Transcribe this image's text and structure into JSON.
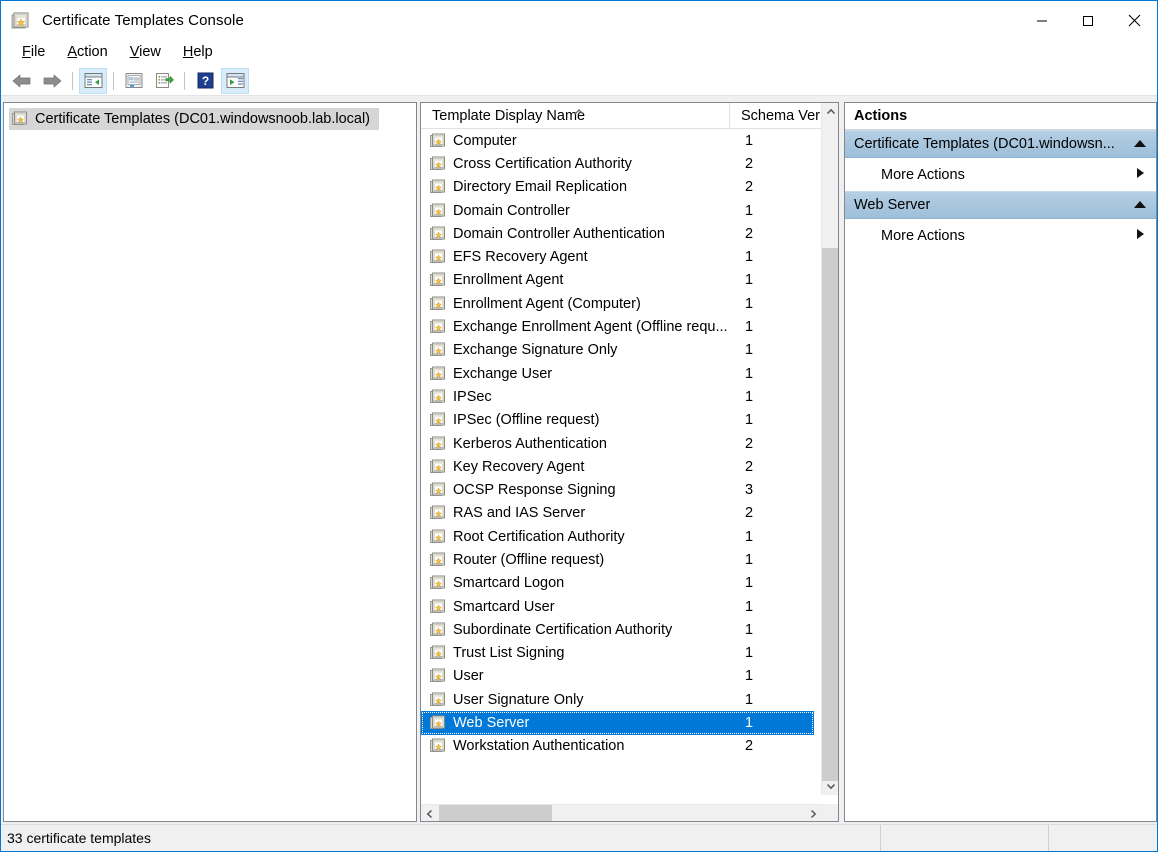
{
  "window": {
    "title": "Certificate Templates Console",
    "icon": "certificate-template-icon",
    "controls": {
      "minimize": "Minimize",
      "maximize": "Maximize",
      "close": "Close"
    }
  },
  "menu": {
    "items": [
      "File",
      "Action",
      "View",
      "Help"
    ]
  },
  "toolbar": {
    "buttons": [
      {
        "name": "back-button",
        "icon": "back-arrow-icon",
        "active": false
      },
      {
        "name": "forward-button",
        "icon": "forward-arrow-icon",
        "active": false
      },
      {
        "name": "show-hide-tree-button",
        "icon": "console-tree-icon",
        "active": true
      },
      {
        "name": "properties-button",
        "icon": "properties-icon",
        "active": false
      },
      {
        "name": "export-list-button",
        "icon": "export-list-icon",
        "active": false
      },
      {
        "name": "help-button",
        "icon": "help-icon",
        "active": false
      },
      {
        "name": "show-hide-action-pane-button",
        "icon": "action-pane-icon",
        "active": true
      }
    ]
  },
  "tree": {
    "root": {
      "label": "Certificate Templates (DC01.windowsnoob.lab.local)",
      "icon": "certificate-template-icon",
      "selected": true
    }
  },
  "list": {
    "columns": [
      "Template Display Name",
      "Schema Ver"
    ],
    "sort": {
      "column": "Template Display Name",
      "direction": "ascending"
    },
    "rows": [
      {
        "name": "Computer",
        "version": "1",
        "selected": false
      },
      {
        "name": "Cross Certification Authority",
        "version": "2",
        "selected": false
      },
      {
        "name": "Directory Email Replication",
        "version": "2",
        "selected": false
      },
      {
        "name": "Domain Controller",
        "version": "1",
        "selected": false
      },
      {
        "name": "Domain Controller Authentication",
        "version": "2",
        "selected": false
      },
      {
        "name": "EFS Recovery Agent",
        "version": "1",
        "selected": false
      },
      {
        "name": "Enrollment Agent",
        "version": "1",
        "selected": false
      },
      {
        "name": "Enrollment Agent (Computer)",
        "version": "1",
        "selected": false
      },
      {
        "name": "Exchange Enrollment Agent (Offline requ...",
        "version": "1",
        "selected": false
      },
      {
        "name": "Exchange Signature Only",
        "version": "1",
        "selected": false
      },
      {
        "name": "Exchange User",
        "version": "1",
        "selected": false
      },
      {
        "name": "IPSec",
        "version": "1",
        "selected": false
      },
      {
        "name": "IPSec (Offline request)",
        "version": "1",
        "selected": false
      },
      {
        "name": "Kerberos Authentication",
        "version": "2",
        "selected": false
      },
      {
        "name": "Key Recovery Agent",
        "version": "2",
        "selected": false
      },
      {
        "name": "OCSP Response Signing",
        "version": "3",
        "selected": false
      },
      {
        "name": "RAS and IAS Server",
        "version": "2",
        "selected": false
      },
      {
        "name": "Root Certification Authority",
        "version": "1",
        "selected": false
      },
      {
        "name": "Router (Offline request)",
        "version": "1",
        "selected": false
      },
      {
        "name": "Smartcard Logon",
        "version": "1",
        "selected": false
      },
      {
        "name": "Smartcard User",
        "version": "1",
        "selected": false
      },
      {
        "name": "Subordinate Certification Authority",
        "version": "1",
        "selected": false
      },
      {
        "name": "Trust List Signing",
        "version": "1",
        "selected": false
      },
      {
        "name": "User",
        "version": "1",
        "selected": false
      },
      {
        "name": "User Signature Only",
        "version": "1",
        "selected": false
      },
      {
        "name": "Web Server",
        "version": "1",
        "selected": true
      },
      {
        "name": "Workstation Authentication",
        "version": "2",
        "selected": false
      }
    ]
  },
  "actions": {
    "title": "Actions",
    "groups": [
      {
        "header": "Certificate Templates (DC01.windowsn...",
        "collapse_icon": "chevron-up-icon",
        "items": [
          {
            "label": "More Actions",
            "submenu_icon": "chevron-right-icon"
          }
        ]
      },
      {
        "header": "Web Server",
        "collapse_icon": "chevron-up-icon",
        "items": [
          {
            "label": "More Actions",
            "submenu_icon": "chevron-right-icon"
          }
        ]
      }
    ]
  },
  "statusbar": {
    "text": "33 certificate templates",
    "pane2": "",
    "pane3": ""
  },
  "colors": {
    "selection_blue": "#0078d7",
    "window_border": "#0078d7",
    "group_header": "#a8c6de",
    "tree_selection": "#d6d6d6"
  }
}
